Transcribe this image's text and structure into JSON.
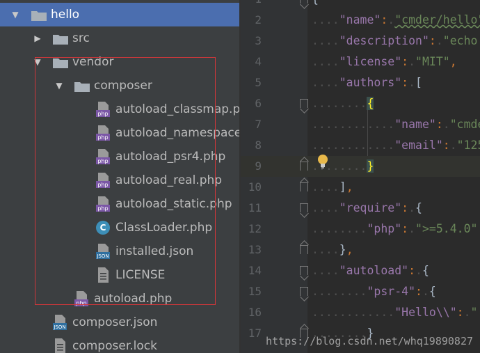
{
  "tree": {
    "items": [
      {
        "label": "hello",
        "type": "folder",
        "expanded": true,
        "selected": true
      },
      {
        "label": "src",
        "type": "folder",
        "expanded": false
      },
      {
        "label": "vendor",
        "type": "folder",
        "expanded": true
      },
      {
        "label": "composer",
        "type": "folder",
        "expanded": true
      },
      {
        "label": "autoload_classmap.php",
        "type": "php"
      },
      {
        "label": "autoload_namespaces.php",
        "type": "php"
      },
      {
        "label": "autoload_psr4.php",
        "type": "php"
      },
      {
        "label": "autoload_real.php",
        "type": "php"
      },
      {
        "label": "autoload_static.php",
        "type": "php"
      },
      {
        "label": "ClassLoader.php",
        "type": "class"
      },
      {
        "label": "installed.json",
        "type": "json"
      },
      {
        "label": "LICENSE",
        "type": "text"
      },
      {
        "label": "autoload.php",
        "type": "php"
      },
      {
        "label": "composer.json",
        "type": "json"
      },
      {
        "label": "composer.lock",
        "type": "text"
      }
    ],
    "badges": {
      "php": "php",
      "json": "JSON",
      "class": "C"
    }
  },
  "editor": {
    "lines": [
      {
        "num": "1",
        "text": "{"
      },
      {
        "num": "2",
        "text": "....\"name\":.\"cmder/hello\","
      },
      {
        "num": "3",
        "text": "....\"description\":.\"echo"
      },
      {
        "num": "4",
        "text": "....\"license\":.\"MIT\","
      },
      {
        "num": "5",
        "text": "....\"authors\":.["
      },
      {
        "num": "6",
        "text": "........{"
      },
      {
        "num": "7",
        "text": "............\"name\":.\"cmder"
      },
      {
        "num": "8",
        "text": "............\"email\":.\"125"
      },
      {
        "num": "9",
        "text": "........}"
      },
      {
        "num": "10",
        "text": "....],"
      },
      {
        "num": "11",
        "text": "....\"require\":.{"
      },
      {
        "num": "12",
        "text": "........\"php\":.\">=5.4.0\""
      },
      {
        "num": "13",
        "text": "....},"
      },
      {
        "num": "14",
        "text": "....\"autoload\":.{"
      },
      {
        "num": "15",
        "text": "........\"psr-4\":.{"
      },
      {
        "num": "16",
        "text": "............\"Hello\\\\\":.\""
      },
      {
        "num": "17",
        "text": "........}"
      }
    ]
  },
  "watermark": "https://blog.csdn.net/whq19890827",
  "colors": {
    "selection": "#4b6eaf",
    "highlight_box": "#d0373a",
    "json_key": "#9876aa",
    "json_string": "#6a8759",
    "punctuation": "#cc7832"
  }
}
